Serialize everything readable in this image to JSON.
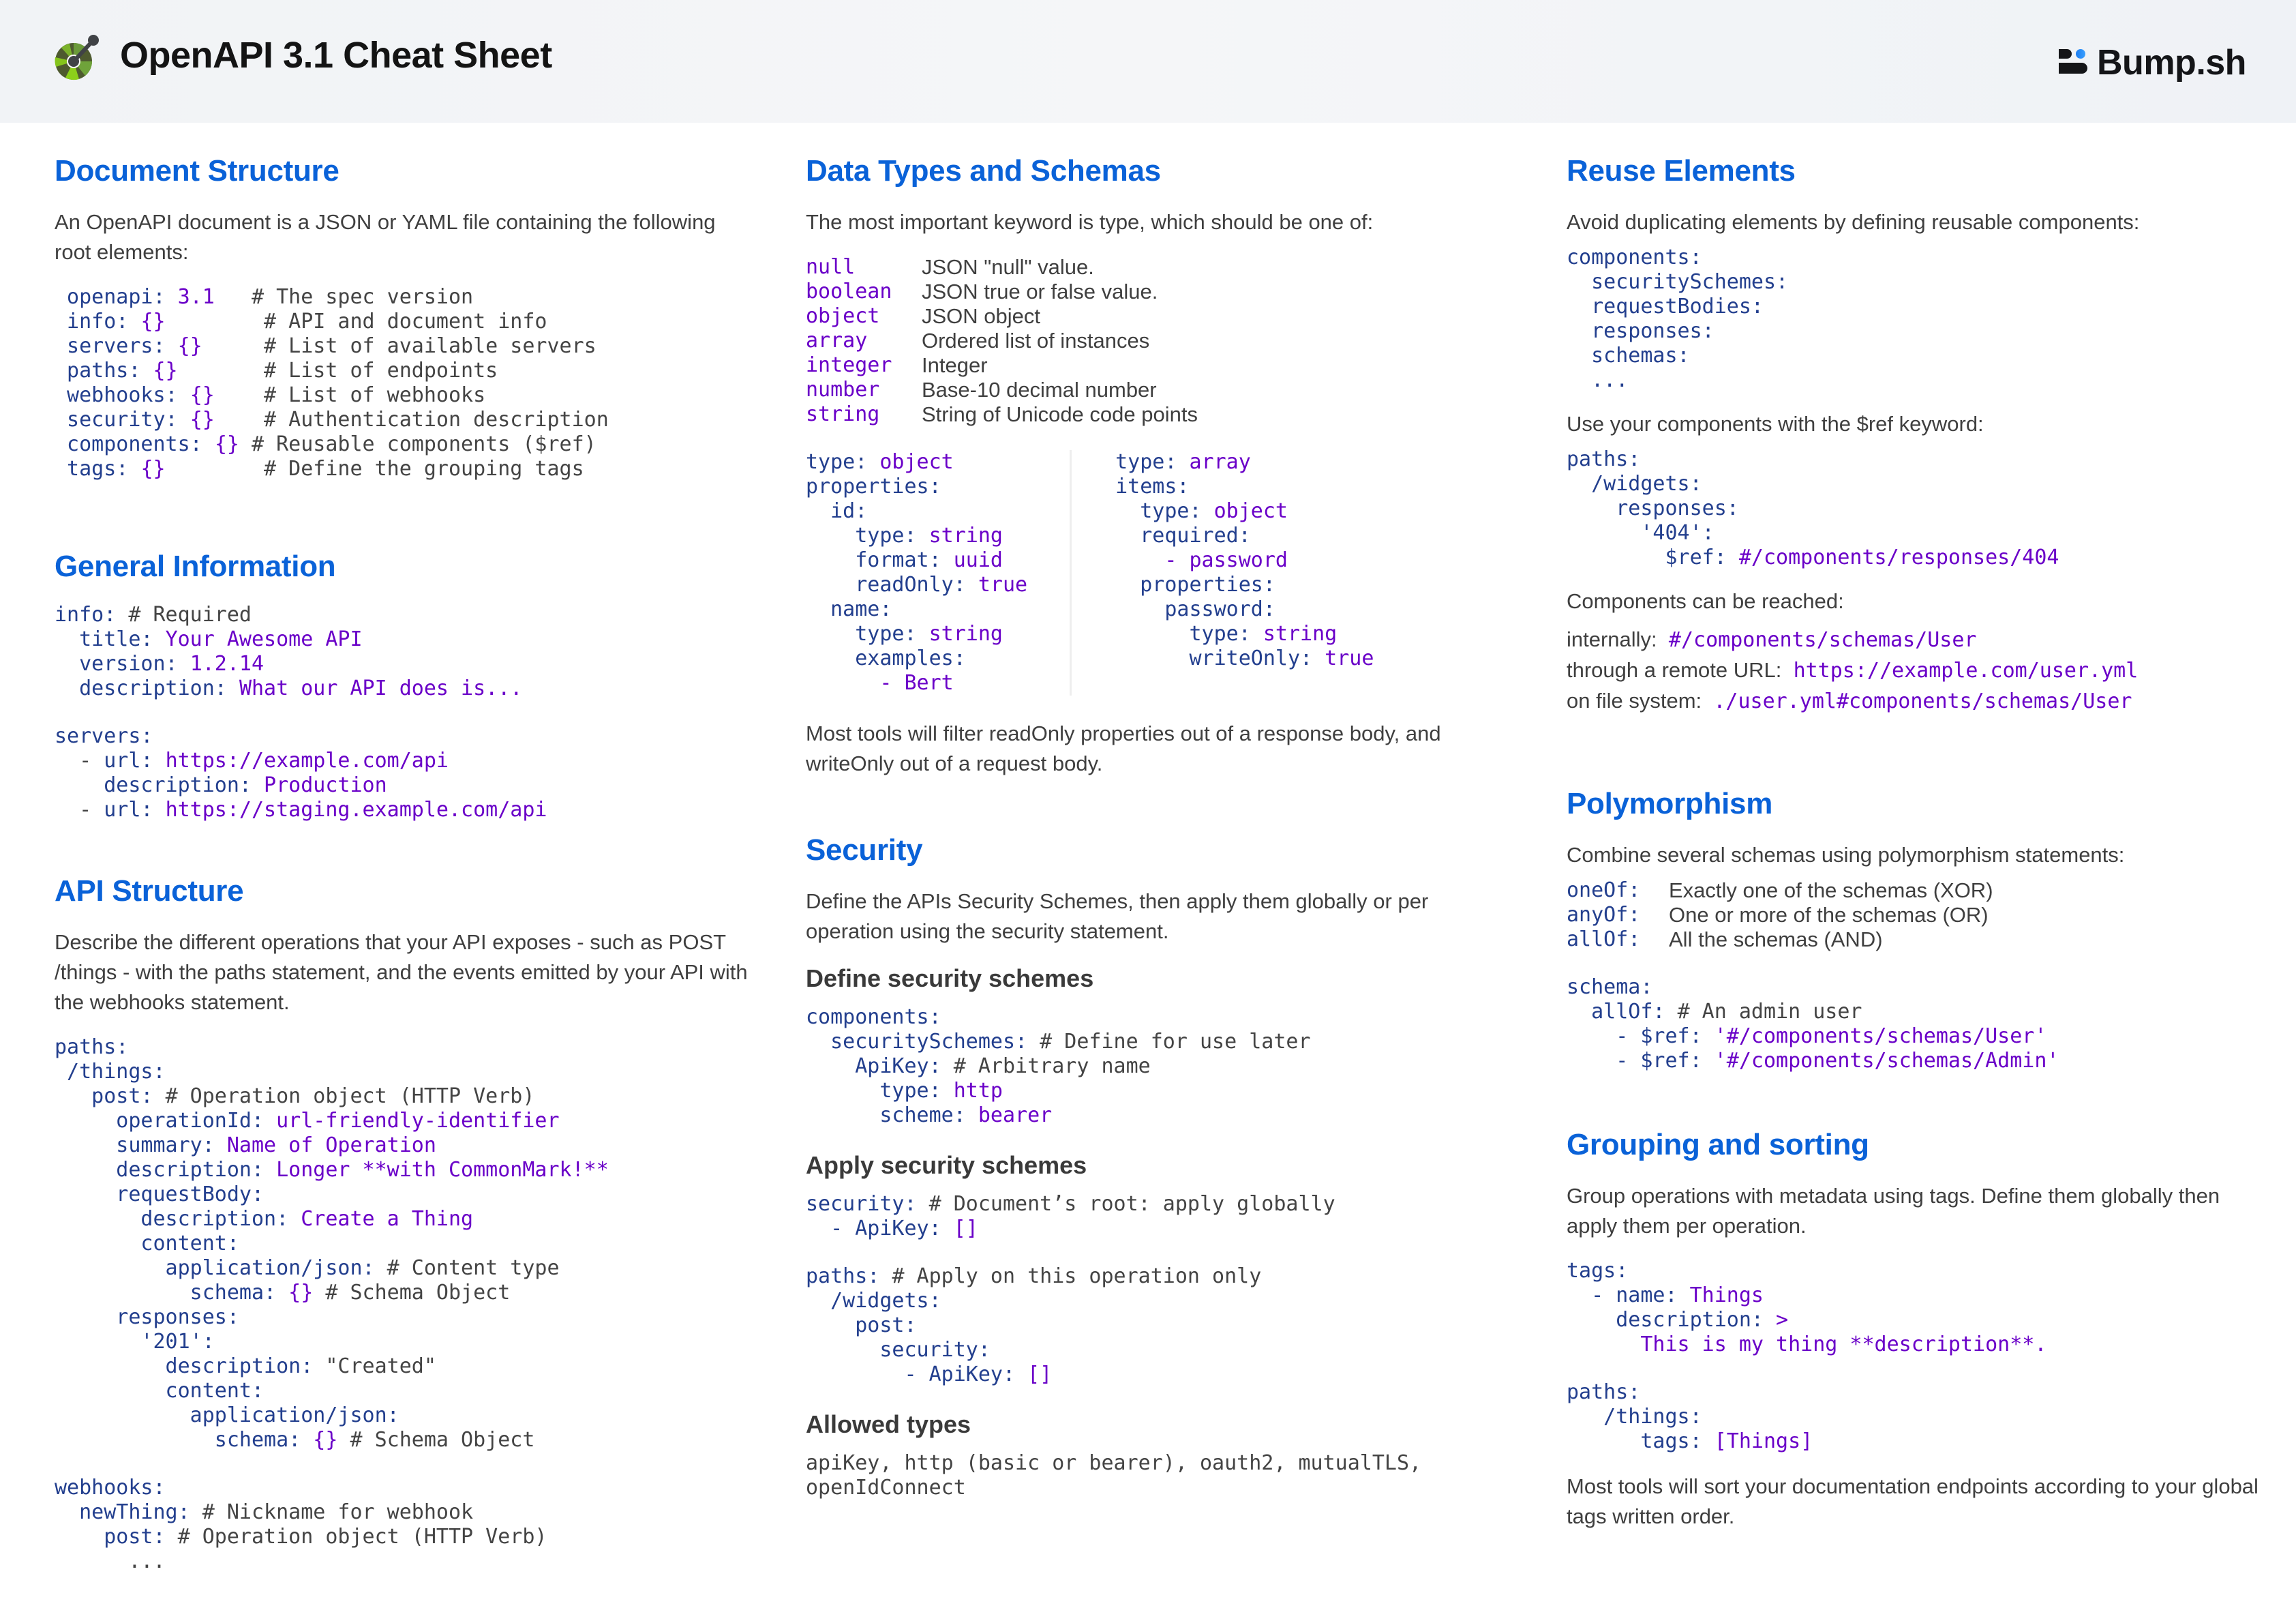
{
  "header": {
    "title": "OpenAPI 3.1 Cheat Sheet",
    "logo_icon": "openapi-logo",
    "brand": "Bump.sh",
    "brand_icon": "bump-logo"
  },
  "colors": {
    "heading": "#0a62d8",
    "key": "#233f8e",
    "value": "#6a00c8",
    "comment": "#444444",
    "text": "#3f3f3f"
  },
  "document_structure": {
    "title": "Document Structure",
    "intro": "An OpenAPI document is a JSON or YAML file containing the following root elements:",
    "lines": [
      [
        {
          "t": "k",
          "s": " openapi: "
        },
        {
          "t": "v",
          "s": "3.1"
        },
        {
          "t": "c",
          "s": "   # The spec version"
        }
      ],
      [
        {
          "t": "k",
          "s": " info: "
        },
        {
          "t": "v",
          "s": "{}"
        },
        {
          "t": "c",
          "s": "        # API and document info"
        }
      ],
      [
        {
          "t": "k",
          "s": " servers: "
        },
        {
          "t": "v",
          "s": "{}"
        },
        {
          "t": "c",
          "s": "     # List of available servers"
        }
      ],
      [
        {
          "t": "k",
          "s": " paths: "
        },
        {
          "t": "v",
          "s": "{}"
        },
        {
          "t": "c",
          "s": "       # List of endpoints"
        }
      ],
      [
        {
          "t": "k",
          "s": " webhooks: "
        },
        {
          "t": "v",
          "s": "{}"
        },
        {
          "t": "c",
          "s": "    # List of webhooks"
        }
      ],
      [
        {
          "t": "k",
          "s": " security: "
        },
        {
          "t": "v",
          "s": "{}"
        },
        {
          "t": "c",
          "s": "    # Authentication description"
        }
      ],
      [
        {
          "t": "k",
          "s": " components: "
        },
        {
          "t": "v",
          "s": "{}"
        },
        {
          "t": "c",
          "s": " # Reusable components ($ref)"
        }
      ],
      [
        {
          "t": "k",
          "s": " tags: "
        },
        {
          "t": "v",
          "s": "{}"
        },
        {
          "t": "c",
          "s": "        # Define the grouping tags"
        }
      ]
    ]
  },
  "general_information": {
    "title": "General Information",
    "info_lines": [
      [
        {
          "t": "k",
          "s": "info: "
        },
        {
          "t": "c",
          "s": "# Required"
        }
      ],
      [
        {
          "t": "k",
          "s": "  title: "
        },
        {
          "t": "v",
          "s": "Your Awesome API"
        }
      ],
      [
        {
          "t": "k",
          "s": "  version: "
        },
        {
          "t": "v",
          "s": "1.2.14"
        }
      ],
      [
        {
          "t": "k",
          "s": "  description: "
        },
        {
          "t": "v",
          "s": "What our API does is..."
        }
      ]
    ],
    "servers_lines": [
      [
        {
          "t": "k",
          "s": "servers:"
        }
      ],
      [
        {
          "t": "c",
          "s": "  - "
        },
        {
          "t": "k",
          "s": "url: "
        },
        {
          "t": "v",
          "s": "https://example.com/api"
        }
      ],
      [
        {
          "t": "k",
          "s": "    description: "
        },
        {
          "t": "v",
          "s": "Production"
        }
      ],
      [
        {
          "t": "c",
          "s": "  - "
        },
        {
          "t": "k",
          "s": "url: "
        },
        {
          "t": "v",
          "s": "https://staging.example.com/api"
        }
      ]
    ]
  },
  "api_structure": {
    "title": "API Structure",
    "intro": "Describe the different operations that your API exposes - such as POST /things - with the paths statement, and the events emitted by your API with the webhooks statement.",
    "paths_lines": [
      [
        {
          "t": "k",
          "s": "paths:"
        }
      ],
      [
        {
          "t": "k",
          "s": " /things:"
        }
      ],
      [
        {
          "t": "k",
          "s": "   post: "
        },
        {
          "t": "c",
          "s": "# Operation object (HTTP Verb)"
        }
      ],
      [
        {
          "t": "k",
          "s": "     operationId: "
        },
        {
          "t": "v",
          "s": "url-friendly-identifier"
        }
      ],
      [
        {
          "t": "k",
          "s": "     summary: "
        },
        {
          "t": "v",
          "s": "Name of Operation"
        }
      ],
      [
        {
          "t": "k",
          "s": "     description: "
        },
        {
          "t": "v",
          "s": "Longer **with CommonMark!**"
        }
      ],
      [
        {
          "t": "k",
          "s": "     requestBody:"
        }
      ],
      [
        {
          "t": "k",
          "s": "       description: "
        },
        {
          "t": "v",
          "s": "Create a Thing"
        }
      ],
      [
        {
          "t": "k",
          "s": "       content:"
        }
      ],
      [
        {
          "t": "k",
          "s": "         application/json: "
        },
        {
          "t": "c",
          "s": "# Content type"
        }
      ],
      [
        {
          "t": "k",
          "s": "           schema: "
        },
        {
          "t": "v",
          "s": "{}"
        },
        {
          "t": "c",
          "s": " # Schema Object"
        }
      ],
      [
        {
          "t": "k",
          "s": "     responses:"
        }
      ],
      [
        {
          "t": "k",
          "s": "       '201':"
        }
      ],
      [
        {
          "t": "k",
          "s": "         description: "
        },
        {
          "t": "c",
          "s": "\"Created\""
        }
      ],
      [
        {
          "t": "k",
          "s": "         content:"
        }
      ],
      [
        {
          "t": "k",
          "s": "           application/json:"
        }
      ],
      [
        {
          "t": "k",
          "s": "             schema: "
        },
        {
          "t": "v",
          "s": "{}"
        },
        {
          "t": "c",
          "s": " # Schema Object"
        }
      ]
    ],
    "webhooks_lines": [
      [
        {
          "t": "k",
          "s": "webhooks:"
        }
      ],
      [
        {
          "t": "k",
          "s": "  newThing: "
        },
        {
          "t": "c",
          "s": "# Nickname for webhook"
        }
      ],
      [
        {
          "t": "k",
          "s": "    post: "
        },
        {
          "t": "c",
          "s": "# Operation object (HTTP Verb)"
        }
      ],
      [
        {
          "t": "c",
          "s": "      ..."
        }
      ]
    ]
  },
  "data_types": {
    "title": "Data Types and Schemas",
    "intro": "The most important keyword is type, which should be one of:",
    "types": [
      {
        "name": "null",
        "desc": "JSON \"null\" value."
      },
      {
        "name": "boolean",
        "desc": "JSON true or false value."
      },
      {
        "name": "object",
        "desc": "JSON object"
      },
      {
        "name": "array",
        "desc": "Ordered list of instances"
      },
      {
        "name": "integer",
        "desc": "Integer"
      },
      {
        "name": "number",
        "desc": "Base-10 decimal number"
      },
      {
        "name": "string",
        "desc": "String of Unicode code points"
      }
    ],
    "object_example": [
      [
        {
          "t": "k",
          "s": "type: "
        },
        {
          "t": "v",
          "s": "object"
        }
      ],
      [
        {
          "t": "k",
          "s": "properties:"
        }
      ],
      [
        {
          "t": "k",
          "s": "  id:"
        }
      ],
      [
        {
          "t": "k",
          "s": "    type: "
        },
        {
          "t": "v",
          "s": "string"
        }
      ],
      [
        {
          "t": "k",
          "s": "    format: "
        },
        {
          "t": "v",
          "s": "uuid"
        }
      ],
      [
        {
          "t": "k",
          "s": "    readOnly: "
        },
        {
          "t": "v",
          "s": "true"
        }
      ],
      [
        {
          "t": "k",
          "s": "  name:"
        }
      ],
      [
        {
          "t": "k",
          "s": "    type: "
        },
        {
          "t": "v",
          "s": "string"
        }
      ],
      [
        {
          "t": "k",
          "s": "    examples:"
        }
      ],
      [
        {
          "t": "v",
          "s": "      - Bert"
        }
      ]
    ],
    "array_example": [
      [
        {
          "t": "k",
          "s": "type: "
        },
        {
          "t": "v",
          "s": "array"
        }
      ],
      [
        {
          "t": "k",
          "s": "items:"
        }
      ],
      [
        {
          "t": "k",
          "s": "  type: "
        },
        {
          "t": "v",
          "s": "object"
        }
      ],
      [
        {
          "t": "k",
          "s": "  required:"
        }
      ],
      [
        {
          "t": "v",
          "s": "    - password"
        }
      ],
      [
        {
          "t": "k",
          "s": "  properties:"
        }
      ],
      [
        {
          "t": "k",
          "s": "    password:"
        }
      ],
      [
        {
          "t": "k",
          "s": "      type: "
        },
        {
          "t": "v",
          "s": "string"
        }
      ],
      [
        {
          "t": "k",
          "s": "      writeOnly: "
        },
        {
          "t": "v",
          "s": "true"
        }
      ]
    ],
    "note": "Most tools will filter readOnly properties out of a response body, and writeOnly out of a request body."
  },
  "security": {
    "title": "Security",
    "intro": "Define the APIs Security Schemes, then apply them globally or per operation using the security statement.",
    "define_title": "Define security schemes",
    "define_lines": [
      [
        {
          "t": "k",
          "s": "components:"
        }
      ],
      [
        {
          "t": "k",
          "s": "  securitySchemes: "
        },
        {
          "t": "c",
          "s": "# Define for use later"
        }
      ],
      [
        {
          "t": "k",
          "s": "    ApiKey: "
        },
        {
          "t": "c",
          "s": "# Arbitrary name"
        }
      ],
      [
        {
          "t": "k",
          "s": "      type: "
        },
        {
          "t": "v",
          "s": "http"
        }
      ],
      [
        {
          "t": "k",
          "s": "      scheme: "
        },
        {
          "t": "v",
          "s": "bearer"
        }
      ]
    ],
    "apply_title": "Apply security schemes",
    "apply_global_lines": [
      [
        {
          "t": "k",
          "s": "security: "
        },
        {
          "t": "c",
          "s": "# Document’s root: apply globally"
        }
      ],
      [
        {
          "t": "k",
          "s": "  - ApiKey: "
        },
        {
          "t": "v",
          "s": "[]"
        }
      ]
    ],
    "apply_op_lines": [
      [
        {
          "t": "k",
          "s": "paths: "
        },
        {
          "t": "c",
          "s": "# Apply on this operation only"
        }
      ],
      [
        {
          "t": "k",
          "s": "  /widgets:"
        }
      ],
      [
        {
          "t": "k",
          "s": "    post:"
        }
      ],
      [
        {
          "t": "k",
          "s": "      security:"
        }
      ],
      [
        {
          "t": "k",
          "s": "        - ApiKey: "
        },
        {
          "t": "v",
          "s": "[]"
        }
      ]
    ],
    "allowed_title": "Allowed types",
    "allowed_text": "apiKey, http (basic or bearer), oauth2, mutualTLS, openIdConnect"
  },
  "reuse": {
    "title": "Reuse Elements",
    "intro": "Avoid duplicating elements by defining reusable components:",
    "components_lines": [
      [
        {
          "t": "k",
          "s": "components:"
        }
      ],
      [
        {
          "t": "k",
          "s": "  securitySchemes:"
        }
      ],
      [
        {
          "t": "k",
          "s": "  requestBodies:"
        }
      ],
      [
        {
          "t": "k",
          "s": "  responses:"
        }
      ],
      [
        {
          "t": "k",
          "s": "  schemas:"
        }
      ],
      [
        {
          "t": "k",
          "s": "  ..."
        }
      ]
    ],
    "ref_intro": "Use your components with the $ref keyword:",
    "ref_lines": [
      [
        {
          "t": "k",
          "s": "paths:"
        }
      ],
      [
        {
          "t": "k",
          "s": "  /widgets:"
        }
      ],
      [
        {
          "t": "k",
          "s": "    responses:"
        }
      ],
      [
        {
          "t": "k",
          "s": "      '404':"
        }
      ],
      [
        {
          "t": "k",
          "s": "        $ref: "
        },
        {
          "t": "v",
          "s": "#/components/responses/404"
        }
      ]
    ],
    "reach_intro": "Components can be reached:",
    "reach": [
      {
        "label": "internally:",
        "value": "#/components/schemas/User"
      },
      {
        "label": "through a remote URL:",
        "value": "https://example.com/user.yml"
      },
      {
        "label": "on file system:",
        "value": "./user.yml#components/schemas/User"
      }
    ]
  },
  "polymorphism": {
    "title": "Polymorphism",
    "intro": "Combine several schemas using polymorphism statements:",
    "keywords": [
      {
        "name": "oneOf:",
        "desc": "Exactly one of the schemas (XOR)"
      },
      {
        "name": "anyOf:",
        "desc": "One or more of the schemas (OR)"
      },
      {
        "name": "allOf:",
        "desc": "All the schemas (AND)"
      }
    ],
    "example_lines": [
      [
        {
          "t": "k",
          "s": "schema:"
        }
      ],
      [
        {
          "t": "k",
          "s": "  allOf: "
        },
        {
          "t": "c",
          "s": "# An admin user"
        }
      ],
      [
        {
          "t": "k",
          "s": "    - $ref: "
        },
        {
          "t": "v",
          "s": "'#/components/schemas/User'"
        }
      ],
      [
        {
          "t": "k",
          "s": "    - $ref: "
        },
        {
          "t": "v",
          "s": "'#/components/schemas/Admin'"
        }
      ]
    ]
  },
  "grouping": {
    "title": "Grouping and sorting",
    "intro": "Group operations with metadata using tags. Define them globally then apply them per operation.",
    "tags_lines": [
      [
        {
          "t": "k",
          "s": "tags:"
        }
      ],
      [
        {
          "t": "k",
          "s": "  - name: "
        },
        {
          "t": "v",
          "s": "Things"
        }
      ],
      [
        {
          "t": "k",
          "s": "    description: "
        },
        {
          "t": "v",
          "s": ">"
        }
      ],
      [
        {
          "t": "v",
          "s": "      This is my thing **description**."
        }
      ]
    ],
    "paths_lines": [
      [
        {
          "t": "k",
          "s": "paths:"
        }
      ],
      [
        {
          "t": "k",
          "s": "   /things:"
        }
      ],
      [
        {
          "t": "k",
          "s": "      tags: "
        },
        {
          "t": "v",
          "s": "[Things]"
        }
      ]
    ],
    "note": "Most tools will sort your documentation endpoints according to your global tags written order."
  }
}
